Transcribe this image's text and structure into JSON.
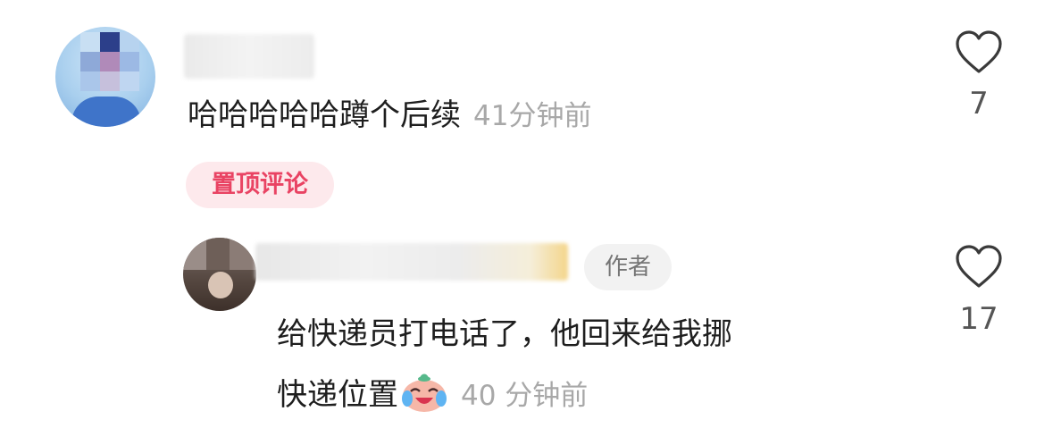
{
  "comments": [
    {
      "text": "哈哈哈哈哈蹲个后续",
      "time": "41分钟前",
      "likes": "7",
      "pinned_label": "置顶评论"
    },
    {
      "author_label": "作者",
      "text_line1": "给快递员打电话了，他回来给我挪",
      "text_line2": "快递位置",
      "time": "40 分钟前",
      "likes": "17",
      "emoji_icon": "crying-laughing-face-icon"
    }
  ],
  "colors": {
    "pinned_text": "#e94363",
    "pinned_bg": "#fde9ec",
    "time_text": "#a8a8a8",
    "author_badge_bg": "#f2f2f2"
  }
}
